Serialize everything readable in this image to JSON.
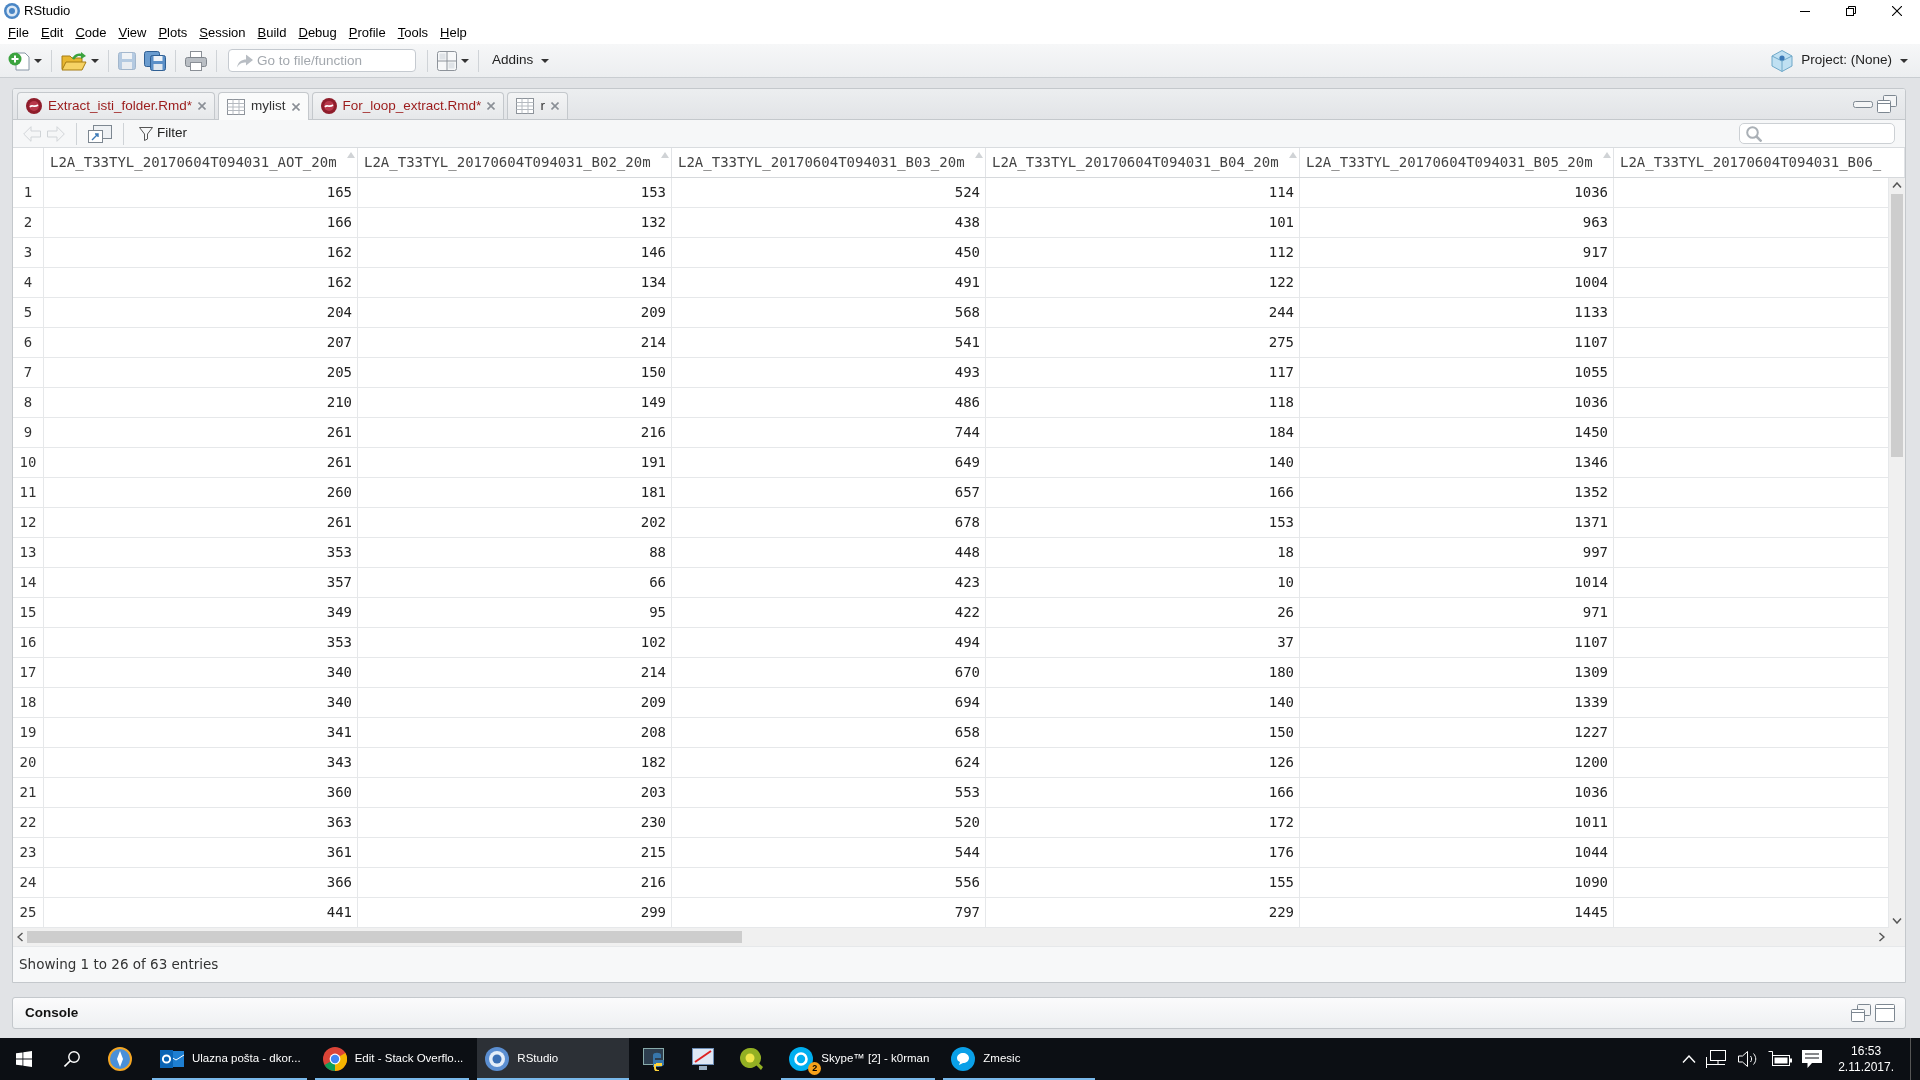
{
  "window": {
    "title": "RStudio"
  },
  "menu": [
    "File",
    "Edit",
    "Code",
    "View",
    "Plots",
    "Session",
    "Build",
    "Debug",
    "Profile",
    "Tools",
    "Help"
  ],
  "toolbar": {
    "groups": [
      [
        {
          "kind": "new",
          "dropdown": true,
          "disabled": false
        }
      ],
      [
        {
          "kind": "open",
          "dropdown": true,
          "disabled": false
        }
      ],
      [
        {
          "kind": "save",
          "dropdown": false,
          "disabled": true
        },
        {
          "kind": "save_all",
          "dropdown": false,
          "disabled": false
        }
      ],
      [
        {
          "kind": "print",
          "dropdown": false,
          "disabled": false
        }
      ],
      [
        {
          "kind": "goto",
          "placeholder": "Go to file/function"
        }
      ],
      [
        {
          "kind": "panes",
          "dropdown": true,
          "disabled": false
        }
      ],
      [
        {
          "kind": "addins",
          "label": "Addins",
          "dropdown": true,
          "disabled": false
        }
      ]
    ],
    "project": {
      "label": "Project: (None)",
      "dropdown": true
    }
  },
  "tabs": [
    {
      "label": "Extract_isti_folder.Rmd*",
      "kind": "rmd",
      "modified": true,
      "selected": false
    },
    {
      "label": "mylist",
      "kind": "data",
      "modified": false,
      "selected": true
    },
    {
      "label": "For_loop_extract.Rmd*",
      "kind": "rmd",
      "modified": true,
      "selected": false
    },
    {
      "label": "r",
      "kind": "data",
      "modified": false,
      "selected": false
    }
  ],
  "data_toolbar": {
    "groups": [
      [
        {
          "kind": "back",
          "disabled": true
        },
        {
          "kind": "forward",
          "disabled": true
        }
      ],
      [
        {
          "kind": "popout",
          "disabled": false
        }
      ],
      [
        {
          "kind": "filter",
          "label": "Filter"
        }
      ]
    ]
  },
  "table": {
    "columns": [
      {
        "label": "L2A_T33TYL_20170604T094031_AOT_20m",
        "sort_icon": true
      },
      {
        "label": "L2A_T33TYL_20170604T094031_B02_20m",
        "sort_icon": true
      },
      {
        "label": "L2A_T33TYL_20170604T094031_B03_20m",
        "sort_icon": true
      },
      {
        "label": "L2A_T33TYL_20170604T094031_B04_20m",
        "sort_icon": true
      },
      {
        "label": "L2A_T33TYL_20170604T094031_B05_20m",
        "sort_icon": true
      },
      {
        "label": "L2A_T33TYL_20170604T094031_B06_",
        "sort_icon": false
      }
    ],
    "rows": [
      {
        "number": "1",
        "cells": [
          "165",
          "153",
          "524",
          "114",
          "1036"
        ]
      },
      {
        "number": "2",
        "cells": [
          "166",
          "132",
          "438",
          "101",
          "963"
        ]
      },
      {
        "number": "3",
        "cells": [
          "162",
          "146",
          "450",
          "112",
          "917"
        ]
      },
      {
        "number": "4",
        "cells": [
          "162",
          "134",
          "491",
          "122",
          "1004"
        ]
      },
      {
        "number": "5",
        "cells": [
          "204",
          "209",
          "568",
          "244",
          "1133"
        ]
      },
      {
        "number": "6",
        "cells": [
          "207",
          "214",
          "541",
          "275",
          "1107"
        ]
      },
      {
        "number": "7",
        "cells": [
          "205",
          "150",
          "493",
          "117",
          "1055"
        ]
      },
      {
        "number": "8",
        "cells": [
          "210",
          "149",
          "486",
          "118",
          "1036"
        ]
      },
      {
        "number": "9",
        "cells": [
          "261",
          "216",
          "744",
          "184",
          "1450"
        ]
      },
      {
        "number": "10",
        "cells": [
          "261",
          "191",
          "649",
          "140",
          "1346"
        ]
      },
      {
        "number": "11",
        "cells": [
          "260",
          "181",
          "657",
          "166",
          "1352"
        ]
      },
      {
        "number": "12",
        "cells": [
          "261",
          "202",
          "678",
          "153",
          "1371"
        ]
      },
      {
        "number": "13",
        "cells": [
          "353",
          "88",
          "448",
          "18",
          "997"
        ]
      },
      {
        "number": "14",
        "cells": [
          "357",
          "66",
          "423",
          "10",
          "1014"
        ]
      },
      {
        "number": "15",
        "cells": [
          "349",
          "95",
          "422",
          "26",
          "971"
        ]
      },
      {
        "number": "16",
        "cells": [
          "353",
          "102",
          "494",
          "37",
          "1107"
        ]
      },
      {
        "number": "17",
        "cells": [
          "340",
          "214",
          "670",
          "180",
          "1309"
        ]
      },
      {
        "number": "18",
        "cells": [
          "340",
          "209",
          "694",
          "140",
          "1339"
        ]
      },
      {
        "number": "19",
        "cells": [
          "341",
          "208",
          "658",
          "150",
          "1227"
        ]
      },
      {
        "number": "20",
        "cells": [
          "343",
          "182",
          "624",
          "126",
          "1200"
        ]
      },
      {
        "number": "21",
        "cells": [
          "360",
          "203",
          "553",
          "166",
          "1036"
        ]
      },
      {
        "number": "22",
        "cells": [
          "363",
          "230",
          "520",
          "172",
          "1011"
        ]
      },
      {
        "number": "23",
        "cells": [
          "361",
          "215",
          "544",
          "176",
          "1044"
        ]
      },
      {
        "number": "24",
        "cells": [
          "366",
          "216",
          "556",
          "155",
          "1090"
        ]
      },
      {
        "number": "25",
        "cells": [
          "441",
          "299",
          "797",
          "229",
          "1445"
        ]
      }
    ]
  },
  "status": "Showing 1 to 26 of 63 entries",
  "console": {
    "title": "Console"
  },
  "taskbar": {
    "items": [
      {
        "kind": "start",
        "open": false,
        "selected": false
      },
      {
        "kind": "search",
        "open": false,
        "selected": false
      },
      {
        "kind": "compass",
        "open": false,
        "selected": false
      },
      {
        "kind": "mail",
        "label": "Ulazna pošta - dkor...",
        "open": true,
        "selected": false
      },
      {
        "kind": "browser",
        "label": "Edit - Stack Overflo...",
        "open": true,
        "selected": false
      },
      {
        "kind": "rstudio",
        "label": "RStudio",
        "open": true,
        "selected": true
      },
      {
        "kind": "console",
        "open": false,
        "selected": false
      },
      {
        "kind": "monitor",
        "open": false,
        "selected": false
      },
      {
        "kind": "leaf",
        "open": false,
        "selected": false
      },
      {
        "kind": "ring",
        "label": "Skype™ [2] - k0rman",
        "badge": "2",
        "open": true,
        "selected": false
      },
      {
        "kind": "chat",
        "label": "Zmesic",
        "open": true,
        "selected": false
      }
    ],
    "clock": {
      "time": "16:53",
      "date": "2.11.2017."
    }
  }
}
